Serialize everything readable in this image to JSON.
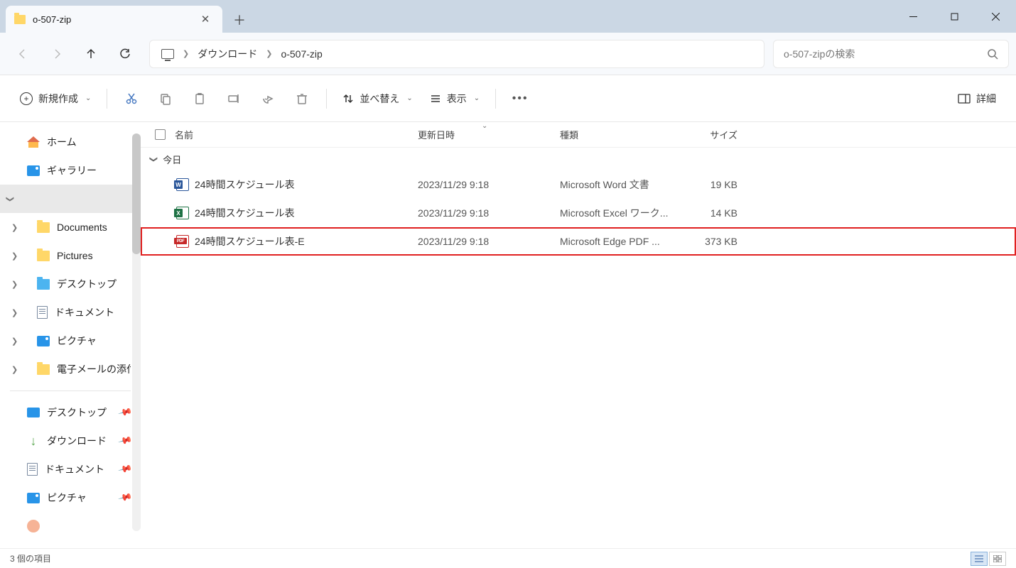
{
  "tab": {
    "title": "o-507-zip"
  },
  "breadcrumb": {
    "seg1": "ダウンロード",
    "seg2": "o-507-zip"
  },
  "search": {
    "placeholder": "o-507-zipの検索"
  },
  "toolbar": {
    "new": "新規作成",
    "sort": "並べ替え",
    "view": "表示",
    "details": "詳細"
  },
  "columns": {
    "name": "名前",
    "date": "更新日時",
    "type": "種類",
    "size": "サイズ"
  },
  "group": {
    "today": "今日"
  },
  "files": [
    {
      "name": "24時間スケジュール表",
      "date": "2023/11/29 9:18",
      "type": "Microsoft Word 文書",
      "size": "19 KB"
    },
    {
      "name": "24時間スケジュール表",
      "date": "2023/11/29 9:18",
      "type": "Microsoft Excel ワーク...",
      "size": "14 KB"
    },
    {
      "name": "24時間スケジュール表-E",
      "date": "2023/11/29 9:18",
      "type": "Microsoft Edge PDF ...",
      "size": "373 KB"
    }
  ],
  "sidebar": {
    "home": "ホーム",
    "gallery": "ギャラリー",
    "documents": "Documents",
    "pictures": "Pictures",
    "desktop": "デスクトップ",
    "document": "ドキュメント",
    "picture": "ピクチャ",
    "email": "電子メールの添付",
    "desktop2": "デスクトップ",
    "download": "ダウンロード",
    "document2": "ドキュメント",
    "picture2": "ピクチャ"
  },
  "status": {
    "text": "3 個の項目"
  }
}
